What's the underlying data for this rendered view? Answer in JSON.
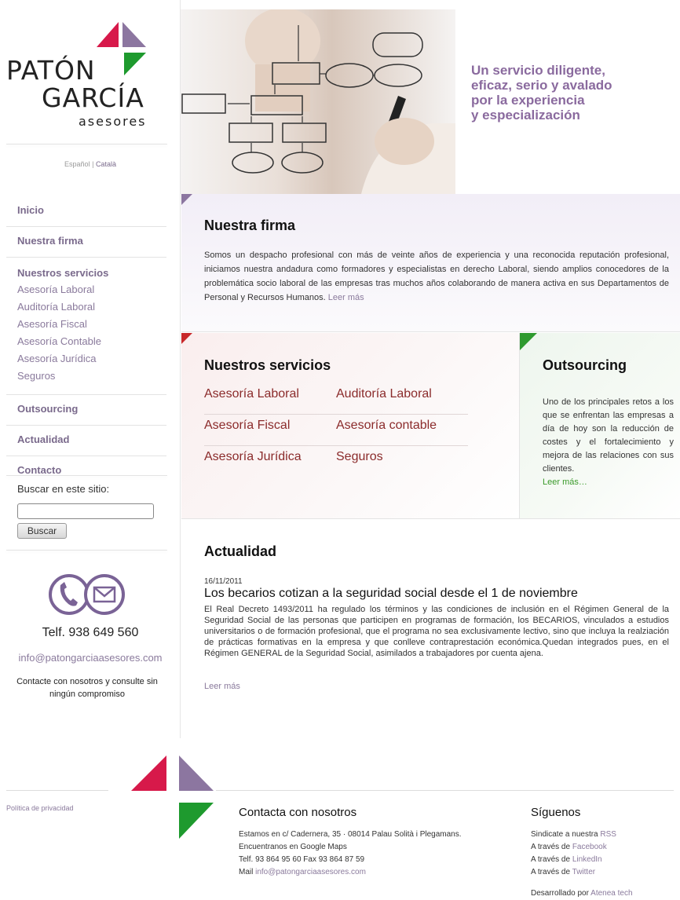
{
  "brand": {
    "line1": "PATÓN",
    "line2": "GARCÍA",
    "line3": "asesores",
    "colors": {
      "red": "#d7194a",
      "purple": "#8c76a0",
      "green": "#1e9a2e"
    }
  },
  "lang": {
    "es": "Español",
    "sep": "|",
    "ca": "Català"
  },
  "nav": {
    "inicio": "Inicio",
    "firma": "Nuestra firma",
    "servicios": "Nuestros servicios",
    "sub": [
      "Asesoría Laboral",
      "Auditoría Laboral",
      "Asesoría Fiscal",
      "Asesoría Contable",
      "Asesoría Jurídica",
      "Seguros"
    ],
    "outsourcing": "Outsourcing",
    "actualidad": "Actualidad",
    "contacto": "Contacto"
  },
  "search": {
    "label": "Buscar en este sitio:",
    "value": "",
    "button": "Buscar"
  },
  "sidebar_contact": {
    "phone": "Telf. 938 649 560",
    "email": "info@patongarciaasesores.com",
    "note": "Contacte con nosotros y consulte sin ningún compromiso",
    "icons": [
      "phone-icon",
      "envelope-icon"
    ]
  },
  "hero": {
    "tagline": [
      "Un servicio diligente,",
      "eficaz, serio y avalado",
      "por la experiencia",
      "y especialización"
    ]
  },
  "firma": {
    "title": "Nuestra firma",
    "text": "Somos un despacho profesional con más de veinte años de experiencia y una reconocida reputación profesional, iniciamos nuestra andadura como formadores y especialistas en derecho Laboral, siendo amplios conocedores de la problemática socio laboral de las empresas tras muchos años colaborando de manera activa en sus Departamentos de Personal y Recursos Humanos.",
    "more": "Leer más"
  },
  "servicios": {
    "title": "Nuestros servicios",
    "rows": [
      [
        "Asesoría Laboral",
        "Auditoría Laboral"
      ],
      [
        "Asesoría Fiscal",
        "Asesoría contable"
      ],
      [
        "Asesoría Jurídica",
        "Seguros"
      ]
    ]
  },
  "outsourcing": {
    "title": "Outsourcing",
    "text": "Uno de los principales retos a los que se enfrentan las empresas a día de hoy son la reducción de costes y el fortalecimiento y mejora de las relaciones con sus clientes.",
    "more": "Leer más…"
  },
  "actualidad": {
    "title": "Actualidad",
    "date": "16/11/2011",
    "headline": "Los becarios cotizan a la seguridad social desde el 1 de noviembre",
    "body": "El Real Decreto 1493/2011 ha regulado los términos y las condiciones de inclusión en el Régimen General de la Seguridad Social de las personas que participen en programas de formación, los BECARIOS, vinculados a estudios universitarios o de formación profesional, que el programa no sea exclusivamente lectivo, sino que incluya la realziación de prácticas formativas en la empresa y que conlleve contraprestación económica.Quedan integrados pues, en el Régimen GENERAL de la Seguridad Social, asimilados a trabajadores por cuenta ajena.",
    "more": "Leer más"
  },
  "footer": {
    "privacy": "Política de privacidad",
    "contact": {
      "title": "Contacta con nosotros",
      "address": "Estamos en c/ Cadernera, 35 · 08014 Palau Solità i Plegamans.",
      "maps": "Encuentranos en Google Maps",
      "phones": "Telf. 93 864 95 60 Fax 93 864 87 59",
      "mail_prefix": "Mail",
      "mail": "info@patongarciaasesores.com"
    },
    "follow": {
      "title": "Síguenos",
      "rss_prefix": "Sindicate a nuestra",
      "rss": "RSS",
      "fb_prefix": "A través de",
      "fb": "Facebook",
      "li_prefix": "A través de",
      "li": "LinkedIn",
      "tw_prefix": "A través de",
      "tw": "Twitter"
    },
    "dev_prefix": "Desarrollado por",
    "dev": "Atenea tech"
  }
}
